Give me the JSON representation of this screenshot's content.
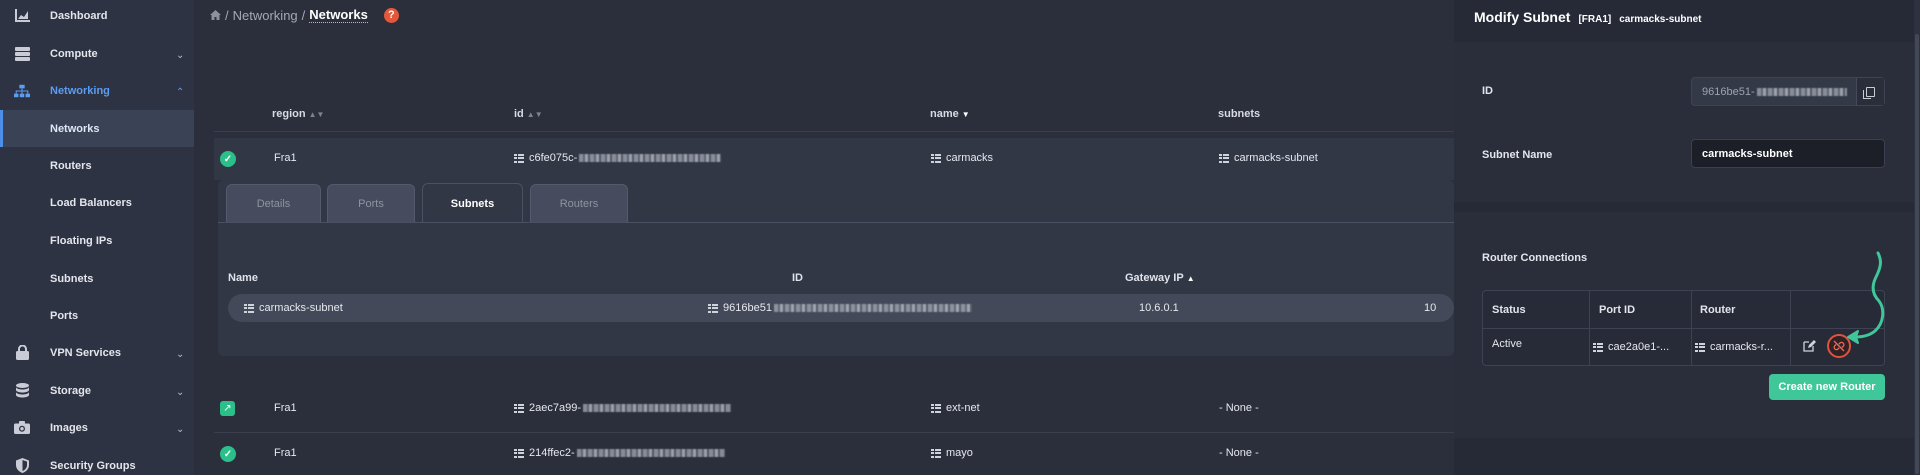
{
  "sidebar": {
    "items": [
      {
        "label": "Dashboard",
        "icon": "chart-icon"
      },
      {
        "label": "Compute",
        "icon": "server-icon"
      },
      {
        "label": "Networking",
        "icon": "network-icon"
      },
      {
        "label": "Networks"
      },
      {
        "label": "Routers"
      },
      {
        "label": "Load Balancers"
      },
      {
        "label": "Floating IPs"
      },
      {
        "label": "Subnets"
      },
      {
        "label": "Ports"
      },
      {
        "label": "VPN Services",
        "icon": "lock-icon"
      },
      {
        "label": "Storage",
        "icon": "database-icon"
      },
      {
        "label": "Images",
        "icon": "camera-icon"
      },
      {
        "label": "Security Groups",
        "icon": "shield-icon"
      }
    ]
  },
  "breadcrumb": {
    "sep": "/",
    "parent": "Networking",
    "current": "Networks",
    "help": "?"
  },
  "table": {
    "headers": {
      "region": "region",
      "id": "id",
      "name": "name",
      "subnets": "subnets"
    },
    "rows": [
      {
        "region": "Fra1",
        "id": "c6fe075c-",
        "name": "carmacks",
        "subnets": "carmacks-subnet",
        "status": "active"
      },
      {
        "region": "Fra1",
        "id": "2aec7a99-",
        "name": "ext-net",
        "subnets": "- None -",
        "status": "external"
      },
      {
        "region": "Fra1",
        "id": "214ffec2-",
        "name": "mayo",
        "subnets": "- None -",
        "status": "active"
      }
    ]
  },
  "detail": {
    "tabs": [
      "Details",
      "Ports",
      "Subnets",
      "Routers"
    ],
    "active_tab": "Subnets",
    "headers": {
      "name": "Name",
      "id": "ID",
      "gateway": "Gateway IP"
    },
    "row": {
      "name": "carmacks-subnet",
      "id": "9616be51",
      "gateway": "10.6.0.1",
      "cidr": "10"
    }
  },
  "panel": {
    "title": "Modify Subnet",
    "region": "[FRA1]",
    "subnet_name_title": "carmacks-subnet",
    "id_label": "ID",
    "id_value": "9616be51-",
    "name_label": "Subnet Name",
    "name_value": "carmacks-subnet",
    "router_connections_label": "Router Connections",
    "rc_headers": {
      "status": "Status",
      "port": "Port ID",
      "router": "Router"
    },
    "rc_row": {
      "status": "Active",
      "port": "cae2a0e1-...",
      "router": "carmacks-r..."
    },
    "create_button": "Create new Router"
  },
  "colors": {
    "accent": "#5b9df0",
    "success": "#2bc08a",
    "danger": "#e0533f",
    "create": "#3fc79a"
  }
}
